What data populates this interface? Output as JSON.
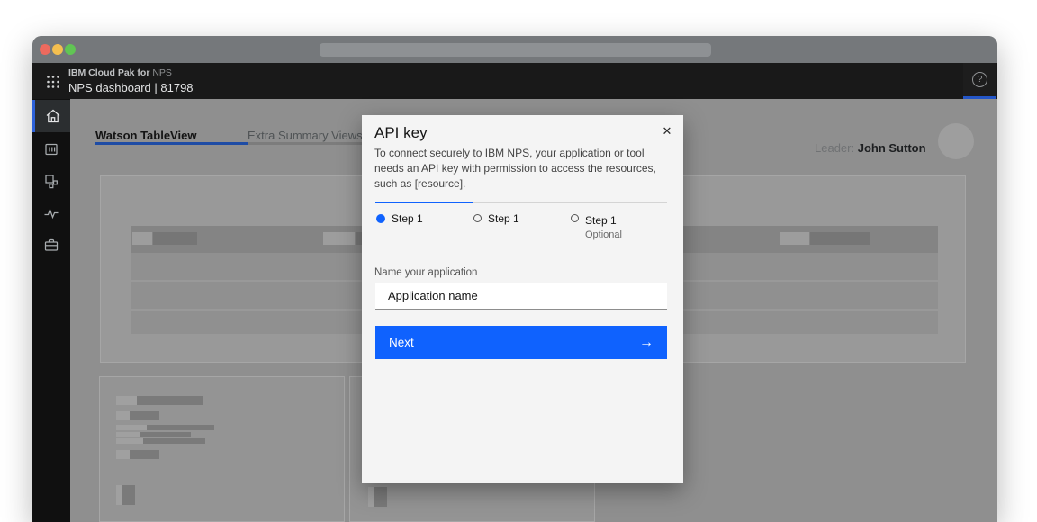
{
  "browser": {
    "traffic_lights": [
      "close",
      "minimize",
      "zoom"
    ]
  },
  "app_header": {
    "eyebrow_prefix": "IBM Cloud Pak for",
    "eyebrow_product": "NPS",
    "title": "NPS dashboard | 81798",
    "help_glyph": "?"
  },
  "sidebar": {
    "items": [
      {
        "icon": "home-icon",
        "active": true
      },
      {
        "icon": "data-table-icon",
        "active": false
      },
      {
        "icon": "workspace-icon",
        "active": false
      },
      {
        "icon": "activity-icon",
        "active": false
      },
      {
        "icon": "toolbox-icon",
        "active": false
      }
    ]
  },
  "tabs": [
    {
      "label": "Watson TableView",
      "active": true
    },
    {
      "label": "Extra Summary Views",
      "active": false
    }
  ],
  "leader": {
    "label": "Leader:",
    "name": "John Sutton"
  },
  "modal": {
    "title": "API key",
    "close_glyph": "✕",
    "description": "To connect securely to IBM NPS, your application or tool needs an API key with permission to access the resources, such as [resource].",
    "steps": [
      {
        "label": "Step 1",
        "state": "current"
      },
      {
        "label": "Step 1",
        "state": "incomplete"
      },
      {
        "label": "Step 1",
        "state": "incomplete",
        "note": "Optional"
      }
    ],
    "form": {
      "label": "Name your application",
      "input_value": "Application name"
    },
    "primary_button": {
      "label": "Next",
      "icon": "→"
    }
  },
  "colors": {
    "accent_blue": "#0f62fe",
    "header_bg": "#161616",
    "modal_bg": "#f4f4f4",
    "dimmed_page_bg": "#8f8f8f",
    "traffic_red": "#ed6a5e",
    "traffic_yellow": "#f4bf4f",
    "traffic_green": "#61c554"
  }
}
